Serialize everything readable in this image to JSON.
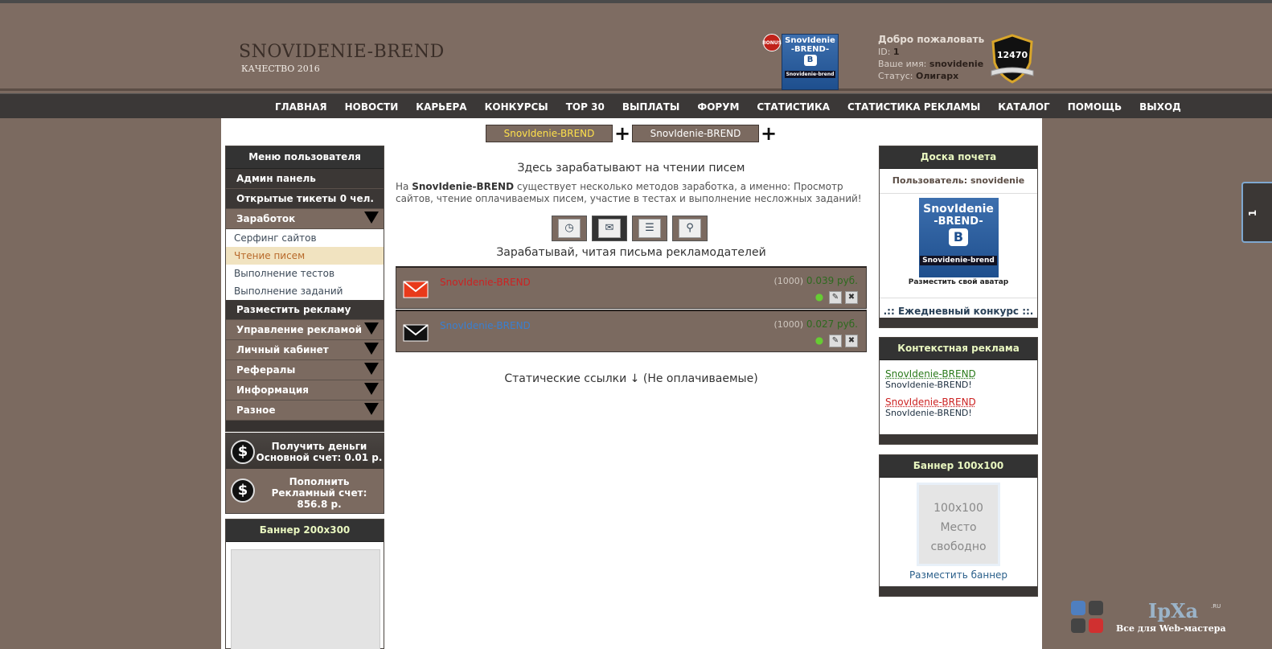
{
  "colors": {
    "brand_brown": "#7b6a60",
    "nav_bg": "#3b3837",
    "highlight_yellow": "#ffe14b",
    "price_green": "#2e6a1e",
    "link_red": "#cc2222",
    "link_blue": "#3a7fd0",
    "link_green": "#2a7a1a"
  },
  "header": {
    "site_title": "SNOVIDENIE-BREND",
    "site_subtitle": "КАЧЕСТВО 2016",
    "bonus_badge": "BONUS",
    "vk_logo": {
      "line1": "SnovIdenie",
      "line2": "-BREND-",
      "letter": "B",
      "caption": "Snovidenie-brend"
    },
    "welcome_title": "Добро пожаловать",
    "id_label": "ID:",
    "id_value": "1",
    "name_label": "Ваше имя:",
    "name_value": "snovidenie",
    "status_label": "Статус:",
    "status_value": "Олигарх",
    "rating": "12470"
  },
  "nav": [
    "ГЛАВНАЯ",
    "НОВОСТИ",
    "КАРЬЕРА",
    "КОНКУРСЫ",
    "TOP 30",
    "ВЫПЛАТЫ",
    "ФОРУМ",
    "СТАТИСТИКА",
    "СТАТИСТИКА РЕКЛАМЫ",
    "КАТАЛОГ",
    "ПОМОЩЬ",
    "ВЫХОД"
  ],
  "top_tabs": [
    "SnovIdenie-BREND",
    "SnovIdenie-BREND"
  ],
  "user_menu": {
    "title": "Меню пользователя",
    "admin": "Админ панель",
    "tickets": "Открытые тикеты",
    "tickets_count": "0 чел.",
    "earnings": "Заработок",
    "earn_items": [
      "Серфинг сайтов",
      "Чтение писем",
      "Выполнение тестов",
      "Выполнение заданий"
    ],
    "place_ad": "Разместить рекламу",
    "sections": [
      "Управление рекламой",
      "Личный кабинет",
      "Рефералы",
      "Информация",
      "Разное"
    ]
  },
  "money": {
    "get_money": "Получить деньги",
    "main_balance": "Основной счет: 0.01 р.",
    "topup": "Пополнить",
    "ad_balance": "Рекламный счет: 856.8 р.",
    "dollar_icon": "$"
  },
  "banner200": {
    "title": "Баннер 200х300"
  },
  "content": {
    "title": "Здесь зарабатывают на чтении писем",
    "intro_prefix": "На",
    "intro_brand": "SnovIdenie-BREND",
    "intro_rest": "существует несколько методов заработка, а именно: Просмотр сайтов, чтение оплачиваемых писем, участие в тестах и выполнение несложных заданий!",
    "subtitle": "Зарабатывай, читая письма рекламодателей",
    "mails": [
      {
        "title": "SnovIdenie-BREND",
        "count": "(1000)",
        "price": "0.039 руб."
      },
      {
        "title": "SnovIdenie-BREND",
        "count": "(1000)",
        "price": "0.027 руб."
      }
    ],
    "static_title": "Статические ссылки ↓ (Не оплачиваемые)"
  },
  "honor": {
    "title": "Доска почета",
    "user": "Пользователь: snovidenie",
    "avatar": {
      "line1": "SnovIdenie",
      "line2": "-BREND-",
      "letter": "B",
      "caption": "Snovidenie-brend"
    },
    "avatar_link": "Разместить свой аватар",
    "contest": ".:: Ежедневный конкурс ::."
  },
  "context_ads": {
    "title": "Контекстная реклама",
    "items": [
      {
        "link": "SnovIdenie-BREND",
        "desc": "SnovIdenie-BREND!"
      },
      {
        "link": "SnovIdenie-BREND",
        "desc": "SnovIdenie-BREND!"
      }
    ]
  },
  "banner100": {
    "title": "Баннер 100х100",
    "l1": "100x100",
    "l2": "Место",
    "l3": "свободно",
    "link": "Разместить баннер"
  },
  "side_tab": "1",
  "watermark": {
    "brand": "IpXa",
    "ru": ".RU",
    "tagline": "Все для Web-мастера"
  }
}
